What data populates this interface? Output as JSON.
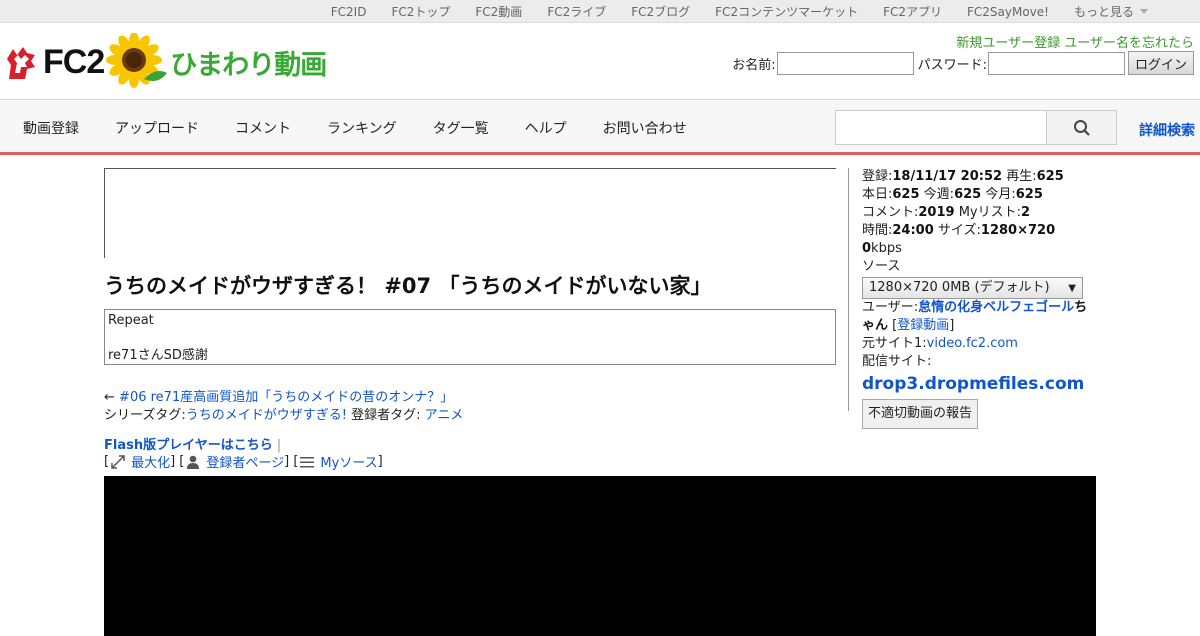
{
  "topbar": {
    "links": [
      "FC2ID",
      "FC2トップ",
      "FC2動画",
      "FC2ライブ",
      "FC2ブログ",
      "FC2コンテンツマーケット",
      "FC2アプリ",
      "FC2SayMove!"
    ],
    "more": "もっと見る"
  },
  "header": {
    "logo_fc2": "FC2",
    "logo_name": "ひまわり動画",
    "register_link": "新規ユーザー登録",
    "forgot_link": "ユーザー名を忘れたら",
    "name_label": "お名前:",
    "password_label": "パスワード:",
    "login_button": "ログイン"
  },
  "nav": {
    "items": [
      "動画登録",
      "アップロード",
      "コメント",
      "ランキング",
      "タグ一覧",
      "ヘルプ",
      "お問い合わせ"
    ],
    "advanced_search": "詳細検索"
  },
  "video": {
    "title": "うちのメイドがウザすぎる！ #07 「うちのメイドがいない家」",
    "desc_line1": "Repeat",
    "desc_line2": "re71さんSD感謝",
    "prev_arrow": "←",
    "prev_link": "#06 re71産高画質追加「うちのメイドの昔のオンナ？」",
    "series_tag_label": "シリーズタグ:",
    "series_tag": "うちのメイドがウザすぎる!",
    "user_tag_label": "登録者タグ:",
    "user_tag": "アニメ",
    "flash_link": "Flash版プレイヤーはこちら",
    "flash_sep": "|",
    "maximize": "最大化",
    "uploader_page": "登録者ページ",
    "my_source": "Myソース"
  },
  "sidebar": {
    "registered_label": "登録:",
    "registered": "18/11/17 20:52",
    "plays_label": "再生:",
    "plays": "625",
    "today_label": "本日:",
    "today": "625",
    "week_label": "今週:",
    "week": "625",
    "month_label": "今月:",
    "month": "625",
    "comments_label": "コメント:",
    "comments": "2019",
    "mylist_label": "Myリスト:",
    "mylist": "2",
    "time_label": "時間:",
    "time": "24:00",
    "size_label": "サイズ:",
    "size": "1280×720",
    "bitrate": "0",
    "bitrate_unit": "kbps",
    "source_label": "ソース",
    "source_option": "1280×720 0MB (デフォルト)",
    "user_label": "ユーザー:",
    "user_name_a": "怠惰の化身ベルフェゴール",
    "user_name_b": "ちゃん",
    "user_videos_link": "登録動画",
    "origin_label": "元サイト1:",
    "origin_site": "video.fc2.com",
    "dist_label": "配信サイト:",
    "dist_site": "drop3.dropmefiles.com",
    "report_button": "不適切動画の報告"
  }
}
